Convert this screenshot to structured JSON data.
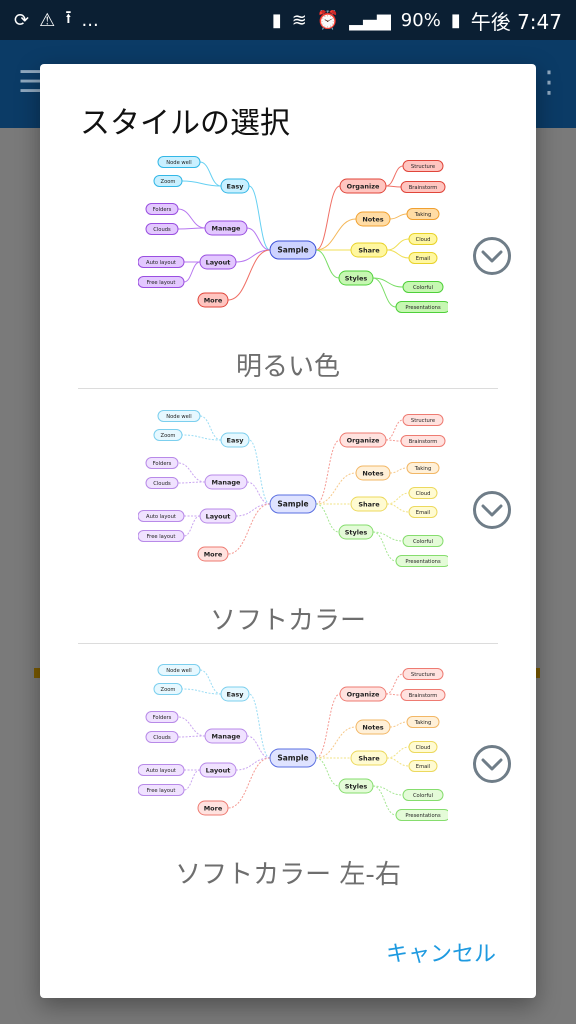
{
  "status_bar": {
    "left_icons": [
      "sync-icon",
      "warning-icon",
      "upload-icon"
    ],
    "ellipsis": "...",
    "right_icons": [
      "battery-saver-icon",
      "vibrate-icon",
      "alarm-icon",
      "volte-icon",
      "4g-icon",
      "signal-icon"
    ],
    "battery": "90%",
    "time": "午後 7:47"
  },
  "dialog": {
    "title": "スタイルの選択",
    "options": [
      {
        "label": "明るい色",
        "style": "bright"
      },
      {
        "label": "ソフトカラー",
        "style": "soft"
      },
      {
        "label": "ソフトカラー 左-右",
        "style": "soft-lr"
      }
    ],
    "cancel_label": "キャンセル"
  },
  "mindmap": {
    "center": "Sample",
    "left": [
      {
        "text": "Easy",
        "children": [
          "Node well",
          "Zoom"
        ]
      },
      {
        "text": "Manage",
        "children": [
          "Folders",
          "Clouds"
        ]
      },
      {
        "text": "Layout",
        "children": [
          "Auto layout",
          "Free layout"
        ]
      },
      {
        "text": "More",
        "children": []
      }
    ],
    "right": [
      {
        "text": "Organize",
        "children": [
          "Structure",
          "Brainstorm"
        ]
      },
      {
        "text": "Notes",
        "children": [
          "Taking"
        ]
      },
      {
        "text": "Share",
        "children": [
          "Cloud",
          "Email"
        ]
      },
      {
        "text": "Styles",
        "children": [
          "Colorful",
          "Presentations"
        ]
      }
    ]
  },
  "colors": {
    "status_bar": "#0b1f33",
    "toolbar": "#0b3b66",
    "accent": "#1e9ae0",
    "chevron": "#6f7d88"
  }
}
